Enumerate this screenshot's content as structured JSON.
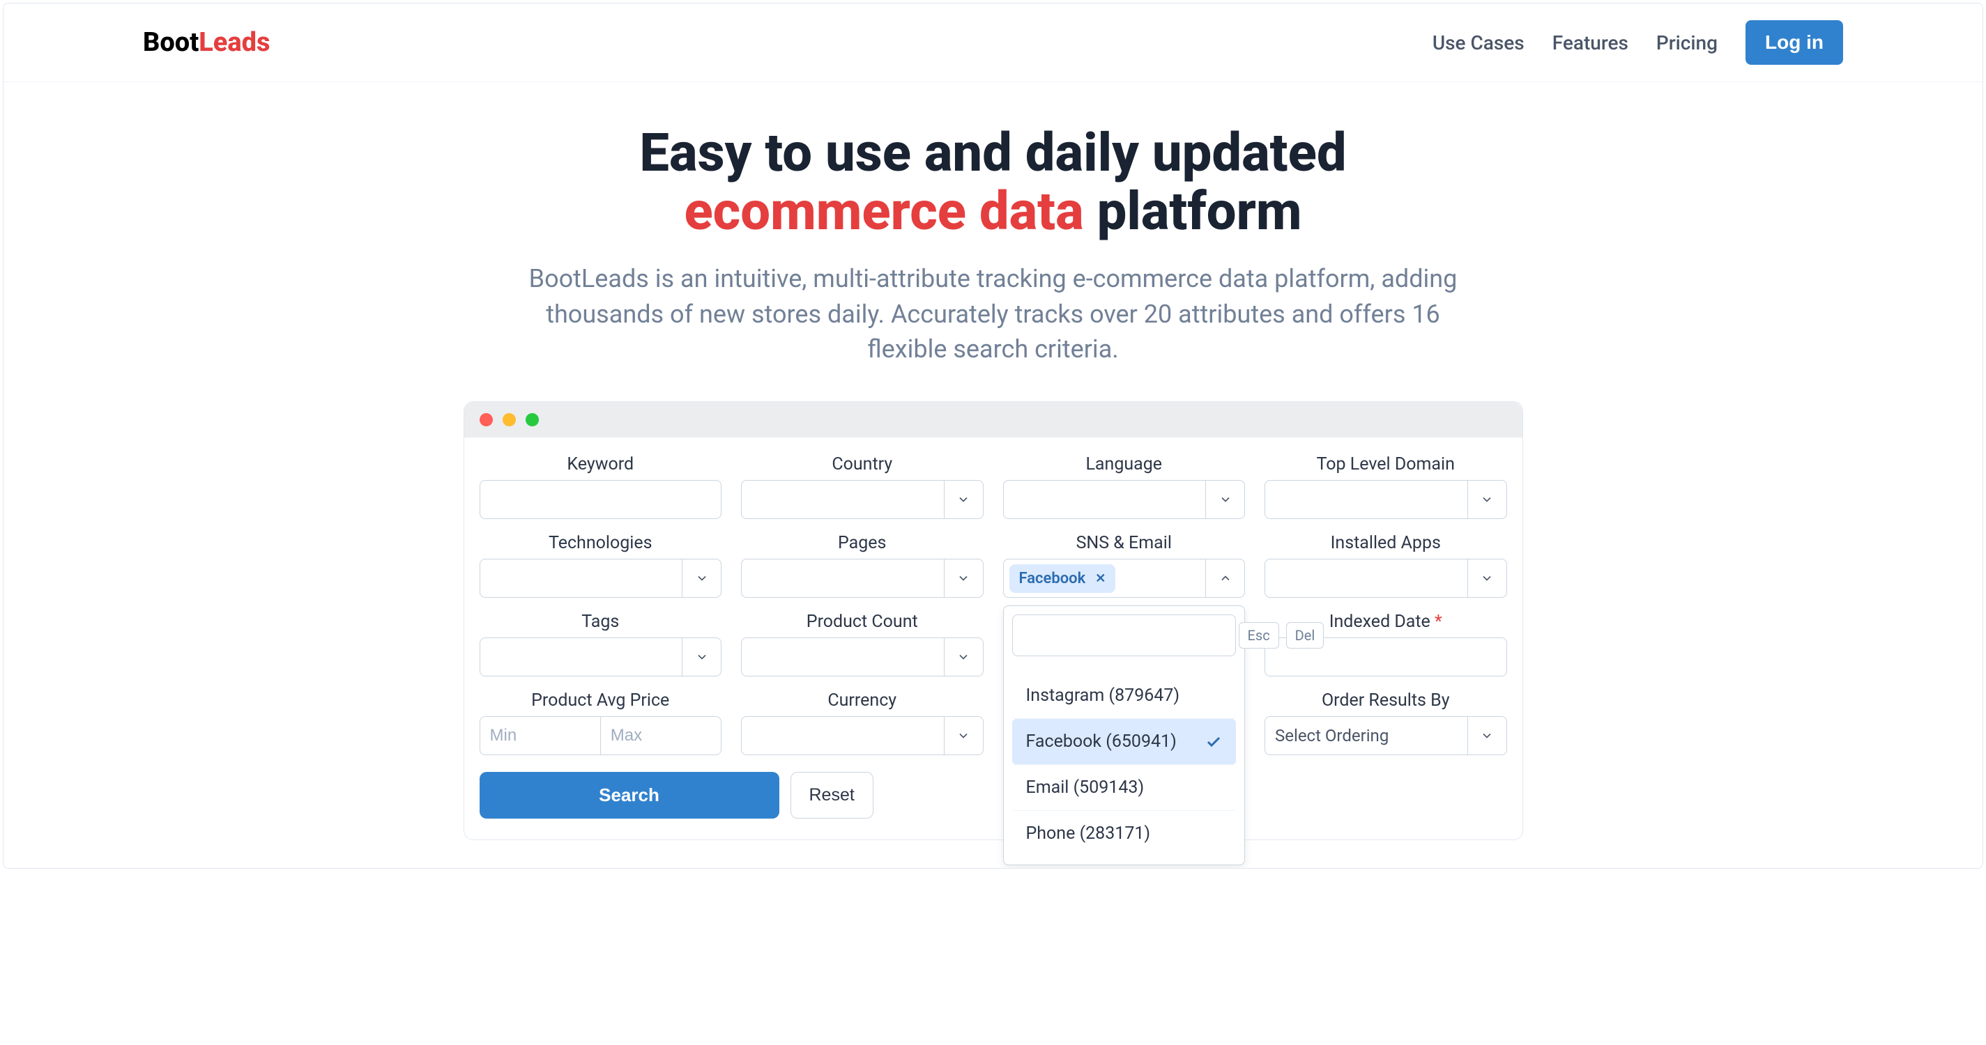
{
  "logo": {
    "part1": "Boot",
    "part2": "Leads"
  },
  "nav": {
    "use_cases": "Use Cases",
    "features": "Features",
    "pricing": "Pricing",
    "login": "Log in"
  },
  "hero": {
    "title_pre": "Easy to use and daily updated",
    "title_accent": "ecommerce data",
    "title_post": " platform",
    "subtitle": "BootLeads is an intuitive, multi-attribute tracking e-commerce data platform, adding thousands of new stores daily. Accurately tracks over 20 attributes and offers 16 flexible search criteria."
  },
  "form": {
    "labels": {
      "keyword": "Keyword",
      "country": "Country",
      "language": "Language",
      "tld": "Top Level Domain",
      "technologies": "Technologies",
      "pages": "Pages",
      "sns_email": "SNS & Email",
      "installed_apps": "Installed Apps",
      "tags": "Tags",
      "product_count": "Product Count",
      "indexed_date": "Indexed Date",
      "product_avg_price": "Product Avg Price",
      "currency": "Currency",
      "order_by": "Order Results By"
    },
    "placeholders": {
      "min": "Min",
      "max": "Max",
      "order_by": "Select Ordering"
    },
    "sns_tag": "Facebook",
    "buttons": {
      "search": "Search",
      "reset": "Reset"
    },
    "dropdown": {
      "esc": "Esc",
      "del": "Del",
      "options": [
        {
          "label": "Instagram (879647)",
          "selected": false
        },
        {
          "label": "Facebook (650941)",
          "selected": true
        },
        {
          "label": "Email (509143)",
          "selected": false
        },
        {
          "label": "Phone (283171)",
          "selected": false
        }
      ]
    }
  }
}
